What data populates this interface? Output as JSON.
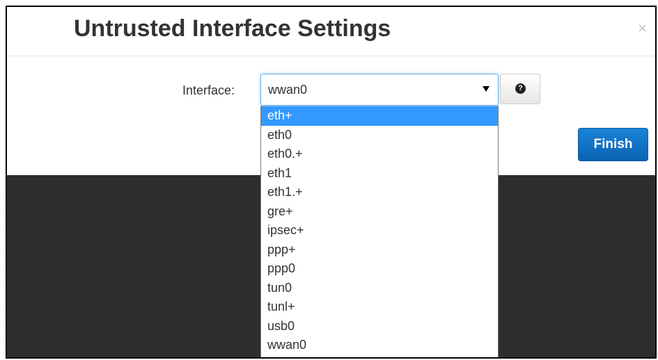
{
  "modal": {
    "title": "Untrusted Interface Settings",
    "close_label": "×"
  },
  "form": {
    "interface_label": "Interface:",
    "interface_value": "wwan0",
    "help_icon": "question-circle-icon",
    "help_glyph": "?"
  },
  "buttons": {
    "finish_label": "Finish"
  },
  "colors": {
    "finish_button": "#0b62b3",
    "highlighted_option": "#3399ff",
    "backdrop": "#2d2d2d"
  },
  "dropdown": {
    "highlighted_index": 0,
    "options": [
      "eth+",
      "eth0",
      "eth0.+",
      "eth1",
      "eth1.+",
      "gre+",
      "ipsec+",
      "ppp+",
      "ppp0",
      "tun0",
      "tunl+",
      "usb0",
      "wwan0"
    ]
  }
}
